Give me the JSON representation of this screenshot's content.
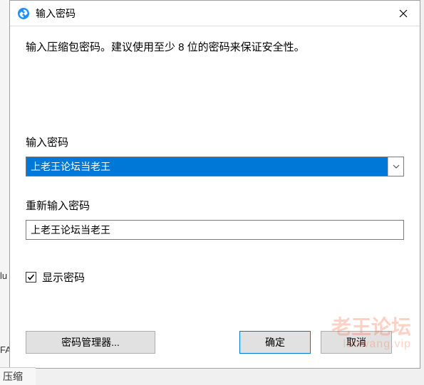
{
  "titlebar": {
    "title": "输入密码"
  },
  "instruction": "输入压缩包密码。建议使用至少 8 位的密码来保证安全性。",
  "password": {
    "label": "输入密码",
    "value": "上老王论坛当老王"
  },
  "confirm": {
    "label": "重新输入密码",
    "value": "上老王论坛当老王"
  },
  "show_password": {
    "label": "显示密码",
    "checked": true
  },
  "buttons": {
    "manager": "密码管理器...",
    "ok": "确定",
    "cancel": "取消"
  },
  "watermark": {
    "main": "老王论坛",
    "sub": "laowang.vip"
  },
  "background": {
    "bottom_label": "压缩",
    "left1": "lu",
    "left2": "FA"
  }
}
